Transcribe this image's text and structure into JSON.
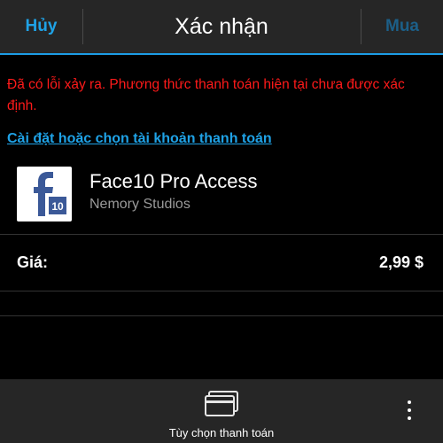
{
  "titlebar": {
    "cancel_label": "Hủy",
    "title": "Xác nhận",
    "buy_label": "Mua"
  },
  "content": {
    "error_message": "Đã có lỗi xảy ra. Phương thức thanh toán hiện tại chưa được xác định.",
    "setup_link": "Cài đặt hoặc chọn tài khoản thanh toán",
    "app": {
      "name": "Face10 Pro Access",
      "developer": "Nemory Studios",
      "icon": "facebook-f-icon",
      "icon_badge": "10"
    },
    "price": {
      "label": "Giá:",
      "value": "2,99 $"
    }
  },
  "actionbar": {
    "payment_options_label": "Tùy chọn thanh toán",
    "payment_icon": "card-stack-icon",
    "more_icon": "overflow-menu-icon"
  },
  "colors": {
    "accent": "#1fa2e6",
    "disabled_accent": "#1c5f88",
    "error": "#ff1a1a",
    "bar_background": "#262626",
    "icon_blue": "#3b5998"
  }
}
